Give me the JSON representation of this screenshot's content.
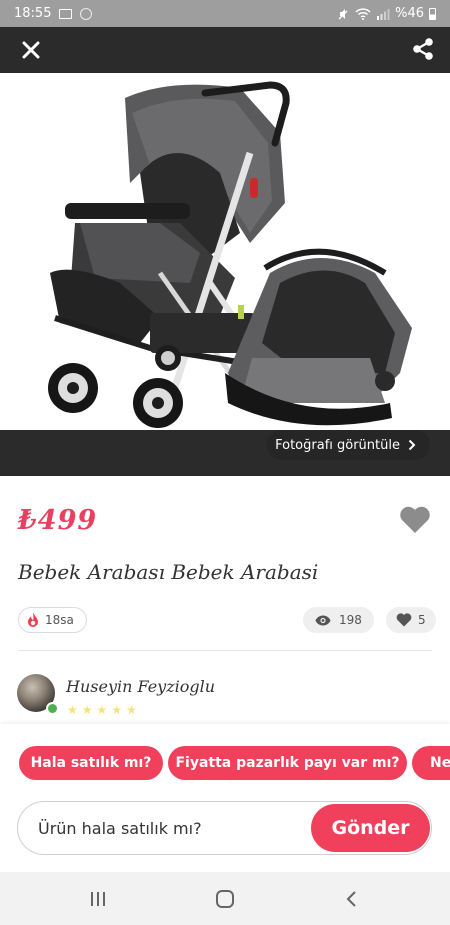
{
  "status_bar": {
    "time": "18:55",
    "battery": "%46"
  },
  "top_bar": {
    "close_icon": "close-icon",
    "share_icon": "share-icon"
  },
  "photo": {
    "view_label": "Fotoğrafı görüntüle"
  },
  "listing": {
    "price": "₺499",
    "title": "Bebek Arabası Bebek Arabasi",
    "time_ago": "18sa",
    "views": "198",
    "likes": "5"
  },
  "seller": {
    "name": "Huseyin Feyzioglu",
    "rating": 0
  },
  "quick_replies": [
    "Hala satılık mı?",
    "Fiyatta pazarlık payı var mı?",
    "Ne"
  ],
  "message": {
    "value": "Ürün hala satılık mı?",
    "send_label": "Gönder"
  },
  "colors": {
    "accent": "#f0405b",
    "dark_bar": "#2b2b2b"
  }
}
